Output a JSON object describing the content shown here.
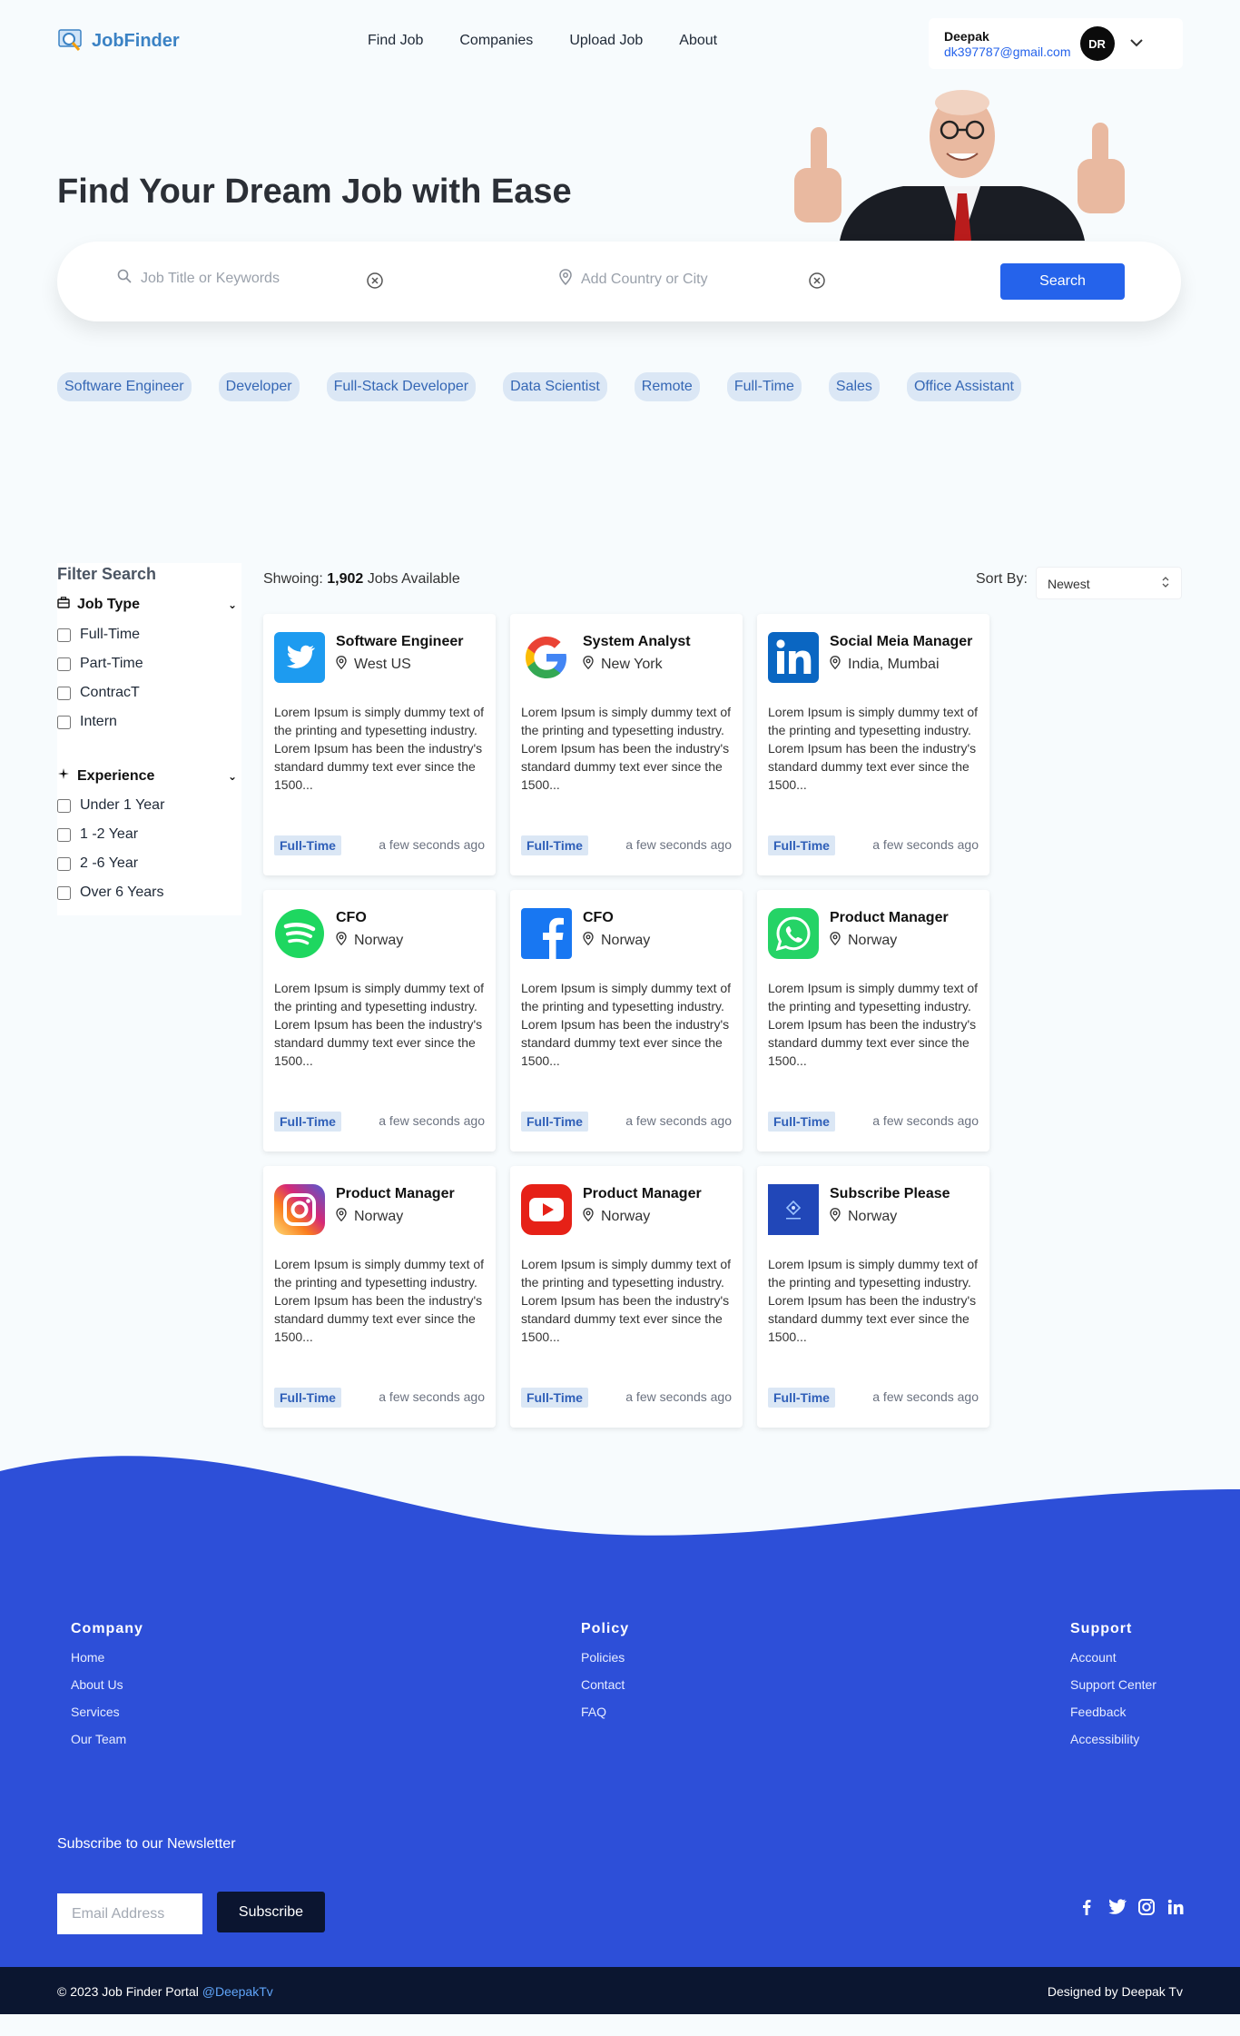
{
  "brand": {
    "name": "JobFinder"
  },
  "nav": {
    "links": [
      "Find Job",
      "Companies",
      "Upload Job",
      "About"
    ]
  },
  "user": {
    "name": "Deepak",
    "email": "dk397787@gmail.com",
    "initials": "DR"
  },
  "hero": {
    "title": "Find Your Dream Job with Ease"
  },
  "search": {
    "keyword_placeholder": "Job Title or Keywords",
    "location_placeholder": "Add Country or City",
    "button_label": "Search"
  },
  "tags": [
    "Software Engineer",
    "Developer",
    "Full-Stack Developer",
    "Data Scientist",
    "Remote",
    "Full-Time",
    "Sales",
    "Office Assistant"
  ],
  "filter": {
    "title": "Filter Search",
    "job_type": {
      "label": "Job Type",
      "options": [
        "Full-Time",
        "Part-Time",
        "ContracT",
        "Intern"
      ]
    },
    "experience": {
      "label": "Experience",
      "options": [
        "Under 1 Year",
        "1 -2 Year",
        "2 -6 Year",
        "Over 6 Years"
      ]
    }
  },
  "results": {
    "prefix": "Shwoing: ",
    "count": "1,902",
    "suffix": " Jobs Available"
  },
  "sort": {
    "label": "Sort By:",
    "value": "Newest"
  },
  "jobs": [
    {
      "title": "Software Engineer",
      "location": "West US",
      "logo": "twitter-logo",
      "type": "Full-Time",
      "time": "a few seconds ago",
      "desc": "Lorem Ipsum is simply dummy text of the printing and typesetting industry. Lorem Ipsum has been the industry's standard dummy text ever since the 1500..."
    },
    {
      "title": "System Analyst",
      "location": "New York",
      "logo": "google-logo",
      "type": "Full-Time",
      "time": "a few seconds ago",
      "desc": "Lorem Ipsum is simply dummy text of the printing and typesetting industry. Lorem Ipsum has been the industry's standard dummy text ever since the 1500..."
    },
    {
      "title": "Social Meia Manager",
      "location": "India, Mumbai",
      "logo": "linkedin-logo",
      "type": "Full-Time",
      "time": "a few seconds ago",
      "desc": "Lorem Ipsum is simply dummy text of the printing and typesetting industry. Lorem Ipsum has been the industry's standard dummy text ever since the 1500..."
    },
    {
      "title": "CFO",
      "location": "Norway",
      "logo": "spotify-logo",
      "type": "Full-Time",
      "time": "a few seconds ago",
      "desc": "Lorem Ipsum is simply dummy text of the printing and typesetting industry. Lorem Ipsum has been the industry's standard dummy text ever since the 1500..."
    },
    {
      "title": "CFO",
      "location": "Norway",
      "logo": "facebook-logo",
      "type": "Full-Time",
      "time": "a few seconds ago",
      "desc": "Lorem Ipsum is simply dummy text of the printing and typesetting industry. Lorem Ipsum has been the industry's standard dummy text ever since the 1500..."
    },
    {
      "title": "Product Manager",
      "location": "Norway",
      "logo": "whatsapp-logo",
      "type": "Full-Time",
      "time": "a few seconds ago",
      "desc": "Lorem Ipsum is simply dummy text of the printing and typesetting industry. Lorem Ipsum has been the industry's standard dummy text ever since the 1500..."
    },
    {
      "title": "Product Manager",
      "location": "Norway",
      "logo": "instagram-logo",
      "type": "Full-Time",
      "time": "a few seconds ago",
      "desc": "Lorem Ipsum is simply dummy text of the printing and typesetting industry. Lorem Ipsum has been the industry's standard dummy text ever since the 1500..."
    },
    {
      "title": "Product Manager",
      "location": "Norway",
      "logo": "youtube-logo",
      "type": "Full-Time",
      "time": "a few seconds ago",
      "desc": "Lorem Ipsum is simply dummy text of the printing and typesetting industry. Lorem Ipsum has been the industry's standard dummy text ever since the 1500..."
    },
    {
      "title": "Subscribe Please",
      "location": "Norway",
      "logo": "codewave-logo",
      "type": "Full-Time",
      "time": "a few seconds ago",
      "desc": "Lorem Ipsum is simply dummy text of the printing and typesetting industry. Lorem Ipsum has been the industry's standard dummy text ever since the 1500..."
    }
  ],
  "footer": {
    "company": {
      "title": "Company",
      "links": [
        "Home",
        "About Us",
        "Services",
        "Our Team"
      ]
    },
    "policy": {
      "title": "Policy",
      "links": [
        "Policies",
        "Contact",
        "FAQ"
      ]
    },
    "support": {
      "title": "Support",
      "links": [
        "Account",
        "Support Center",
        "Feedback",
        "Accessibility"
      ]
    },
    "newsletter_title": "Subscribe to our Newsletter",
    "email_placeholder": "Email Address",
    "subscribe_label": "Subscribe",
    "social_icons": [
      "facebook-icon",
      "twitter-icon",
      "instagram-icon",
      "linkedin-icon"
    ],
    "copyright": "© 2023 Job Finder Portal ",
    "copyright_handle": "@DeepakTv",
    "designed_by": "Designed by Deepak Tv"
  },
  "colors": {
    "accent": "#2563eb",
    "footer_bg": "#2d4fd8",
    "bottom_bar": "#0b1630",
    "tag_bg": "#dbe7f5"
  }
}
